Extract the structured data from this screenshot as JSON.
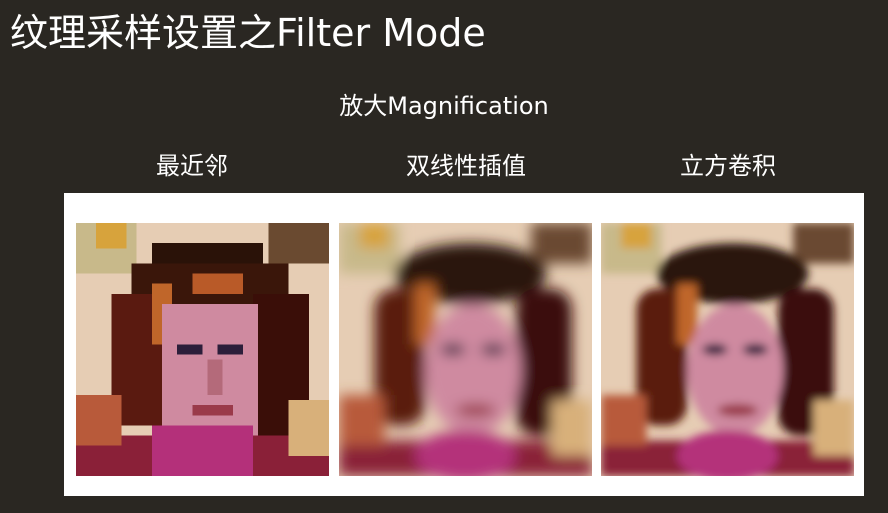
{
  "title": "纹理采样设置之Filter Mode",
  "subtitle": "放大Magnification",
  "columns": [
    {
      "label": "最近邻",
      "filter": "nearest"
    },
    {
      "label": "双线性插值",
      "filter": "bilinear"
    },
    {
      "label": "立方卷积",
      "filter": "bicubic"
    }
  ],
  "colors": {
    "background": "#2a2722",
    "text": "#ffffff",
    "panel": "#ffffff"
  }
}
